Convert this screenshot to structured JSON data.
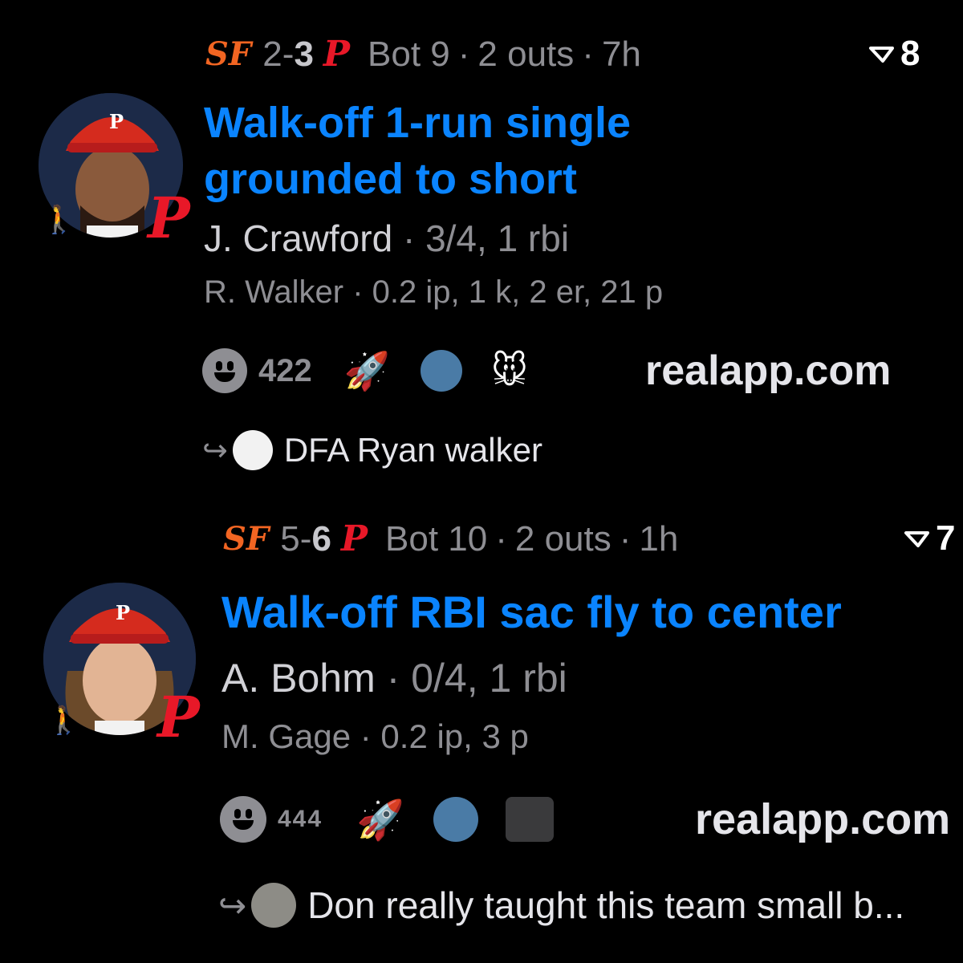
{
  "cards": [
    {
      "away_logo": "SF",
      "score_away": "2",
      "score_sep": "-",
      "score_home": "3",
      "home_logo": "P",
      "inning": "Bot 9",
      "outs": "2 outs",
      "age": "7h",
      "reply_icon": "reply-count-icon",
      "reply_count": "8",
      "headline_line1": "Walk-off 1-run single",
      "headline_line2": "grounded to short",
      "batter_name": "J. Crawford",
      "batter_stats": "3/4, 1 rbi",
      "pitcher_name": "R. Walker",
      "pitcher_stats": "0.2 ip, 1 k, 2 er, 21 p",
      "reaction_count": "422",
      "site": "realapp.com",
      "reply_text": "DFA Ryan walker"
    },
    {
      "away_logo": "SF",
      "score_away": "5",
      "score_sep": "-",
      "score_home": "6",
      "home_logo": "P",
      "inning": "Bot 10",
      "outs": "2 outs",
      "age": "1h",
      "reply_icon": "reply-count-icon",
      "reply_count": "7",
      "headline_line1": "Walk-off RBI sac fly to center",
      "batter_name": "A. Bohm",
      "batter_stats": "0/4, 1 rbi",
      "pitcher_name": "M. Gage",
      "pitcher_stats": "0.2 ip, 3 p",
      "reaction_count": "444",
      "site": "realapp.com",
      "reply_text": "Don really taught this team small b..."
    }
  ],
  "separator": "·",
  "colors": {
    "headline": "#0a84ff",
    "phillies_red": "#e81828",
    "giants_orange": "#f26522",
    "muted": "#8e8e93"
  }
}
